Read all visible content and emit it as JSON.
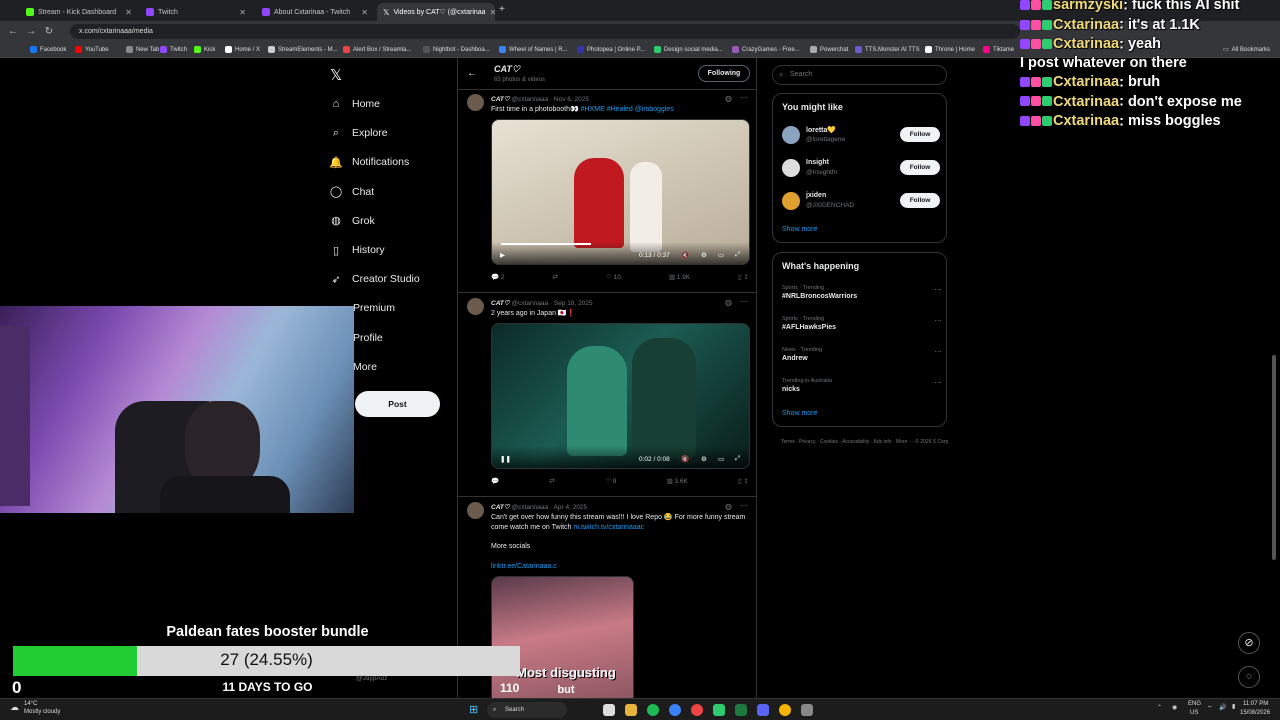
{
  "browser": {
    "tabs": [
      {
        "label": "Stream - Kick Dashboard",
        "color": "#53fc18"
      },
      {
        "label": "Twitch",
        "color": "#9146ff"
      },
      {
        "label": "About Cxtarinaa - Twitch",
        "color": "#9146ff"
      },
      {
        "label": "Videos by CAT♡ (@cxtarinaa",
        "color": "#ffffff"
      }
    ],
    "url": "x.com/cxtarinaaa/media",
    "bookmarks": [
      "Facebook",
      "YouTube",
      "New Tab",
      "Twitch",
      "Kick",
      "Home / X",
      "StreamElements - M...",
      "Alert Box / Streamla...",
      "Nightbot - Dashboa...",
      "Wheel of Names | R...",
      "Photopea | Online P...",
      "Design social media...",
      "CrazyGames - Free...",
      "Powerchat",
      "TTS.Monster AI TTS",
      "Throne | Home",
      "Tiktame"
    ],
    "all_bookmarks": "All Bookmarks"
  },
  "x_nav": {
    "logo": "𝕏",
    "items": [
      {
        "label": "Home",
        "icon": "home-icon",
        "glyph": "⌂"
      },
      {
        "label": "Explore",
        "icon": "search-icon",
        "glyph": "⌕"
      },
      {
        "label": "Notifications",
        "icon": "bell-icon",
        "glyph": "🔔"
      },
      {
        "label": "Chat",
        "icon": "chat-icon",
        "glyph": "◯"
      },
      {
        "label": "Grok",
        "icon": "grok-icon",
        "glyph": "◍"
      },
      {
        "label": "History",
        "icon": "bookmark-icon",
        "glyph": "▯"
      },
      {
        "label": "Creator Studio",
        "icon": "rocket-icon",
        "glyph": "➶"
      },
      {
        "label": "Premium",
        "icon": "x-premium-icon",
        "glyph": "𝕏"
      },
      {
        "label": "Profile",
        "icon": "profile-icon",
        "glyph": "◔"
      },
      {
        "label": "More",
        "icon": "more-icon",
        "glyph": "⋯"
      }
    ],
    "post_label": "Post",
    "profile_handle": "@JaypAuz"
  },
  "profile_header": {
    "name": "CAT♡",
    "subtitle": "65 photos & videos",
    "following_label": "Following"
  },
  "tweets": [
    {
      "name": "CAT♡",
      "handle": "@cxtarinaaa",
      "date": "Nov 6, 2025",
      "text": "First time in a photobooth👀",
      "links": "#HXME #Healed @imboggles",
      "video_time": "0:13 / 0:37",
      "replies": "2",
      "likes": "10",
      "views": "1.9K"
    },
    {
      "name": "CAT♡",
      "handle": "@cxtarinaaa",
      "date": "Sep 18, 2025",
      "text": "2 years ago in Japan 🇯🇵❗",
      "video_time": "0:02 / 0:08",
      "replies": "",
      "likes": "9",
      "views": "3.6K"
    },
    {
      "name": "CAT♡",
      "handle": "@cxtarinaaa",
      "date": "Apr 4, 2025",
      "text": "Can't get over how funny this stream was!!! I love Repo 😂 For more funny stream come watch me on Twitch",
      "twitch_link": "m.twitch.tv/cxtarinaaac",
      "more": "More socials",
      "linktree": "linktr.ee/Catarinaaa.c",
      "caption": "Most disgusting",
      "caption2": "but"
    }
  ],
  "right": {
    "search_placeholder": "Search",
    "might_like_title": "You might like",
    "suggestions": [
      {
        "name": "loretta💛",
        "handle": "@lorettagene",
        "color": "#8aa4c0"
      },
      {
        "name": "Insight",
        "handle": "@Insightfn",
        "color": "#dddddd"
      },
      {
        "name": "jxiden",
        "handle": "@JXIDENCHAD",
        "color": "#e0a030"
      }
    ],
    "follow_label": "Follow",
    "show_more": "Show more",
    "happening_title": "What's happening",
    "trends": [
      {
        "context": "Sports · Trending",
        "title": "#NRLBroncosWarriors"
      },
      {
        "context": "Sports · Trending",
        "title": "#AFLHawksPies"
      },
      {
        "context": "News · Trending",
        "title": "Andrew"
      },
      {
        "context": "Trending in Australia",
        "title": "nicks"
      }
    ],
    "footer": "Terms · Privacy · Cookies · Accessibility · Ads info · More ··· © 2026 X Corp."
  },
  "chat": [
    {
      "user": "sarmzyski",
      "msg": "fuck this AI shit"
    },
    {
      "user": "Cxtarinaa",
      "msg": "it's at 1.1K"
    },
    {
      "user": "Cxtarinaa",
      "msg": "yeah"
    },
    {
      "user": "",
      "msg": "I post whatever on there"
    },
    {
      "user": "Cxtarinaa",
      "msg": "bruh"
    },
    {
      "user": "Cxtarinaa",
      "msg": "don't expose me"
    },
    {
      "user": "Cxtarinaa",
      "msg": "miss boggles"
    }
  ],
  "goal": {
    "title": "Paldean fates booster bundle",
    "progress_text": "27 (24.55%)",
    "progress_fraction": 0.2455,
    "days": "11 DAYS TO GO",
    "start": "0",
    "end": "110"
  },
  "taskbar": {
    "weather_temp": "14°C",
    "weather_desc": "Mostly cloudy",
    "search": "Search",
    "lang": "ENG",
    "region": "US",
    "time": "11:07 PM",
    "date": "15/08/2026"
  }
}
